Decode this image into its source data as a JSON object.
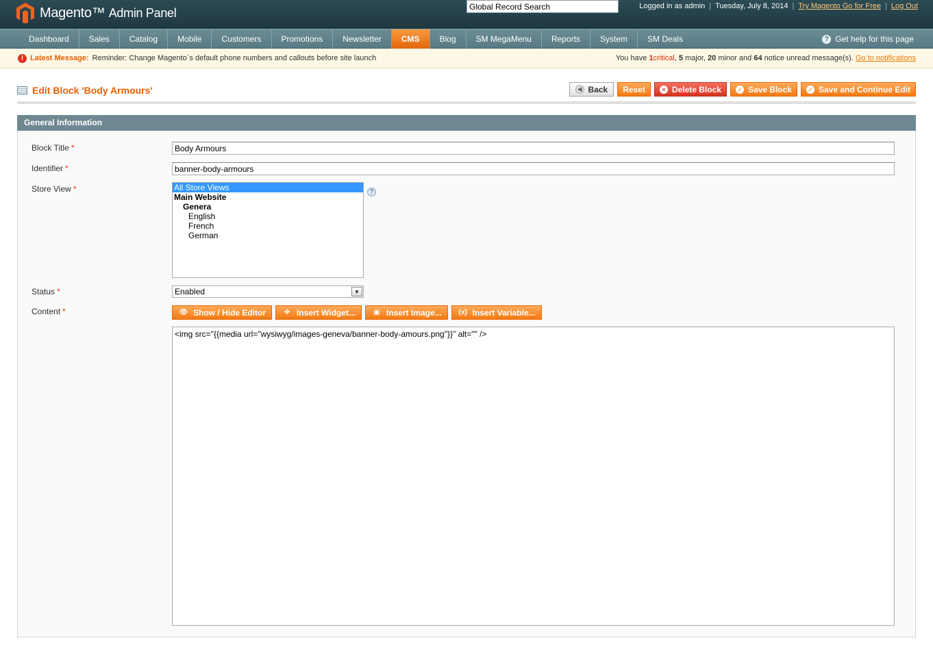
{
  "header": {
    "brand": "Magento",
    "brand_sub": "Admin Panel",
    "search_value": "Global Record Search",
    "logged_in": "Logged in as admin",
    "date": "Tuesday, July 8, 2014",
    "try_link": "Try Magento Go for Free",
    "logout": "Log Out"
  },
  "nav": {
    "items": [
      "Dashboard",
      "Sales",
      "Catalog",
      "Mobile",
      "Customers",
      "Promotions",
      "Newsletter",
      "CMS",
      "Blog",
      "SM MegaMenu",
      "Reports",
      "System",
      "SM Deals"
    ],
    "active": "CMS",
    "help": "Get help for this page"
  },
  "message": {
    "label": "Latest Message:",
    "text": "Reminder: Change Magento`s default phone numbers and callouts before site launch",
    "summary_prefix": "You have",
    "critical_count": "1",
    "critical_label": "critical",
    "major_count": "5",
    "major_label": "major,",
    "minor_count": "20",
    "minor_label": "minor and",
    "notice_count": "64",
    "notice_label": "notice unread message(s).",
    "link": "Go to notifications"
  },
  "page": {
    "title": "Edit Block 'Body Armours'",
    "buttons": {
      "back": "Back",
      "reset": "Reset",
      "delete": "Delete Block",
      "save": "Save Block",
      "save_continue": "Save and Continue Edit"
    }
  },
  "section": {
    "title": "General Information"
  },
  "form": {
    "block_title_label": "Block Title",
    "block_title_value": "Body Armours",
    "identifier_label": "Identifier",
    "identifier_value": "banner-body-armours",
    "store_view_label": "Store View",
    "store_options": {
      "all": "All Store Views",
      "website": "Main Website",
      "store": "Genera",
      "view1": "English",
      "view2": "French",
      "view3": "German"
    },
    "status_label": "Status",
    "status_value": "Enabled",
    "content_label": "Content",
    "editor_buttons": {
      "show_hide": "Show / Hide Editor",
      "widget": "Insert Widget...",
      "image": "Insert Image...",
      "variable": "Insert Variable..."
    },
    "content_value": "<img src=\"{{media url=\"wysiwyg/images-geneva/banner-body-amours.png\"}}\" alt=\"\" />",
    "required_mark": "*"
  },
  "colors": {
    "accent": "#eb5e00",
    "nav_bg": "#6c8c95",
    "header_bg": "#2c4b55",
    "section_bg": "#6f8992"
  }
}
